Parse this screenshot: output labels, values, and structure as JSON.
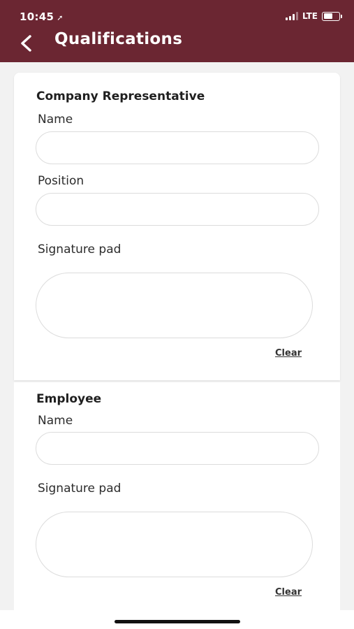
{
  "status_bar": {
    "time": "10:45",
    "location_icon": "location-arrow-icon",
    "network": "LTE"
  },
  "header": {
    "title": "Qualifications",
    "back_icon": "chevron-left-icon",
    "bg_color": "#6b2632"
  },
  "company_representative": {
    "title": "Company Representative",
    "name_label": "Name",
    "name_value": "",
    "position_label": "Position",
    "position_value": "",
    "signature_label": "Signature pad",
    "clear_label": "Clear"
  },
  "employee": {
    "title": "Employee",
    "name_label": "Name",
    "name_value": "",
    "signature_label": "Signature pad",
    "clear_label": "Clear"
  }
}
